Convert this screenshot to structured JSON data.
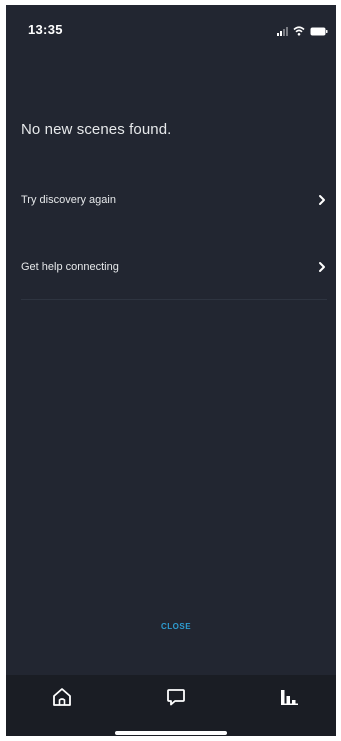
{
  "status_bar": {
    "time": "13:35",
    "icons": [
      "signal-icon",
      "wifi-icon",
      "battery-icon"
    ]
  },
  "main": {
    "title": "No new scenes found.",
    "options": [
      {
        "label": "Try discovery again",
        "icon": "chevron-right-icon"
      },
      {
        "label": "Get help connecting",
        "icon": "chevron-right-icon"
      }
    ]
  },
  "footer": {
    "close_label": "CLOSE"
  },
  "bottom_nav": {
    "items": [
      {
        "icon": "home-icon"
      },
      {
        "icon": "chat-bubble-icon"
      },
      {
        "icon": "bar-chart-icon"
      }
    ]
  },
  "colors": {
    "background": "#222631",
    "nav_background": "#1a1d24",
    "text": "#e6e8ea",
    "accent": "#2e9cd1"
  }
}
